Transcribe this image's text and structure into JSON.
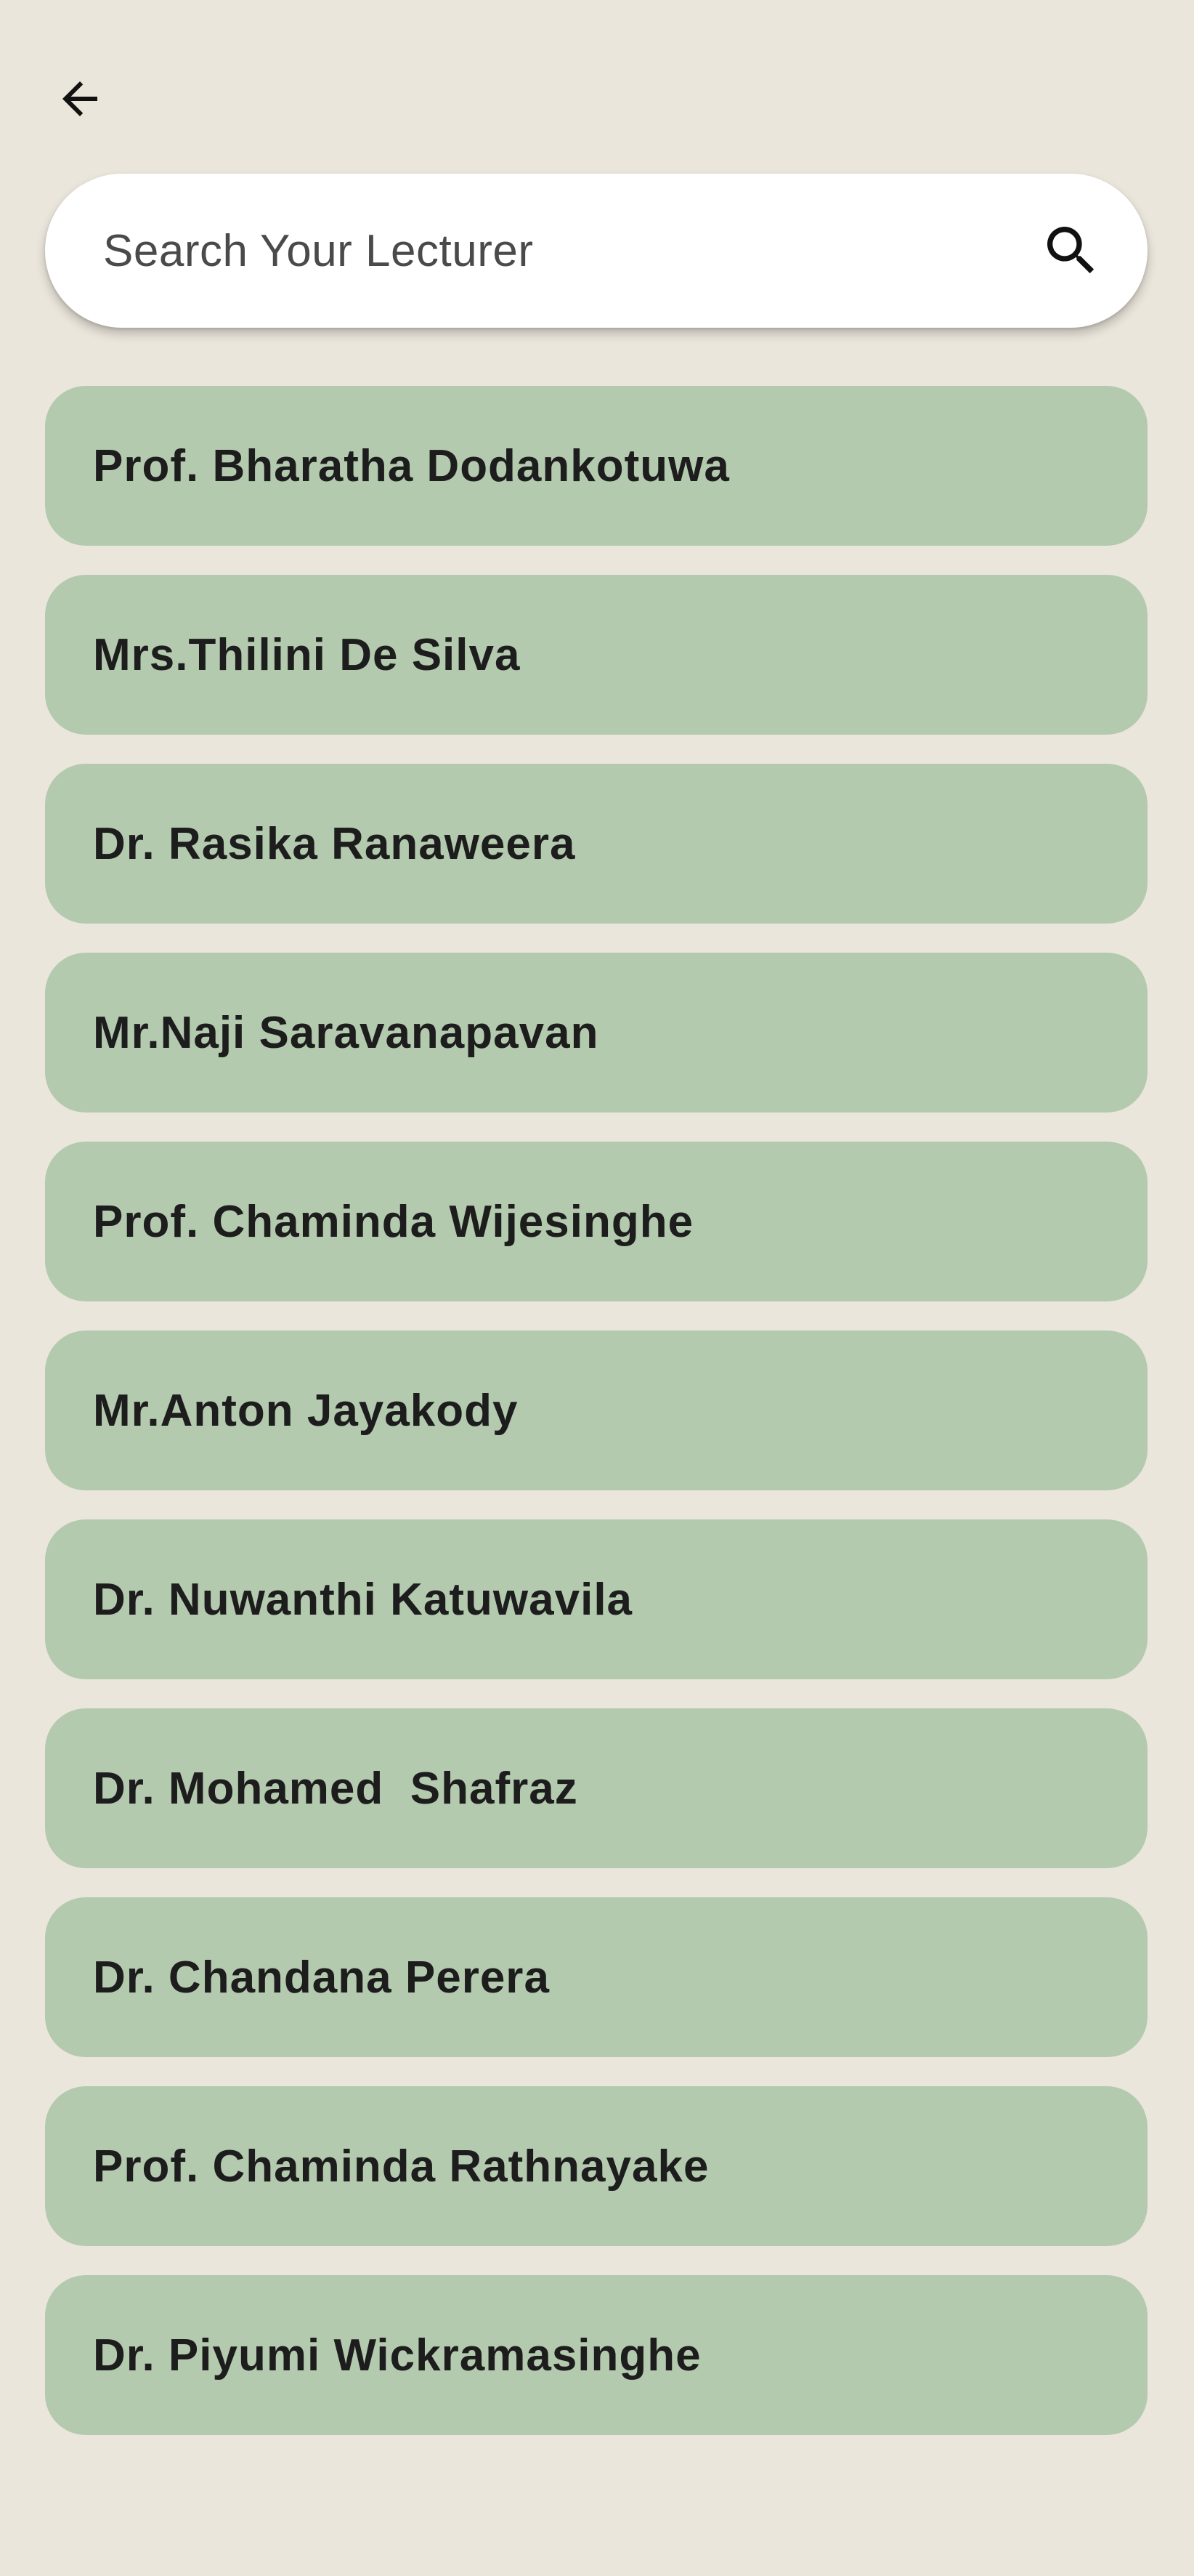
{
  "header": {
    "back_icon": "arrow-left-icon"
  },
  "search": {
    "placeholder": "Search Your Lecturer",
    "value": "",
    "icon": "search-icon"
  },
  "colors": {
    "background": "#ebe6dc",
    "card": "#b3caae",
    "search_bg": "#ffffff",
    "text": "#1d1d1d"
  },
  "lecturers": [
    {
      "name": "Prof. Bharatha Dodankotuwa"
    },
    {
      "name": "Mrs.Thilini De Silva"
    },
    {
      "name": "Dr. Rasika Ranaweera"
    },
    {
      "name": "Mr.Naji Saravanapavan"
    },
    {
      "name": "Prof. Chaminda Wijesinghe"
    },
    {
      "name": "Mr.Anton Jayakody"
    },
    {
      "name": "Dr. Nuwanthi Katuwavila"
    },
    {
      "name": "Dr. Mohamed  Shafraz"
    },
    {
      "name": "Dr. Chandana Perera"
    },
    {
      "name": "Prof. Chaminda Rathnayake"
    },
    {
      "name": "Dr. Piyumi Wickramasinghe"
    }
  ]
}
